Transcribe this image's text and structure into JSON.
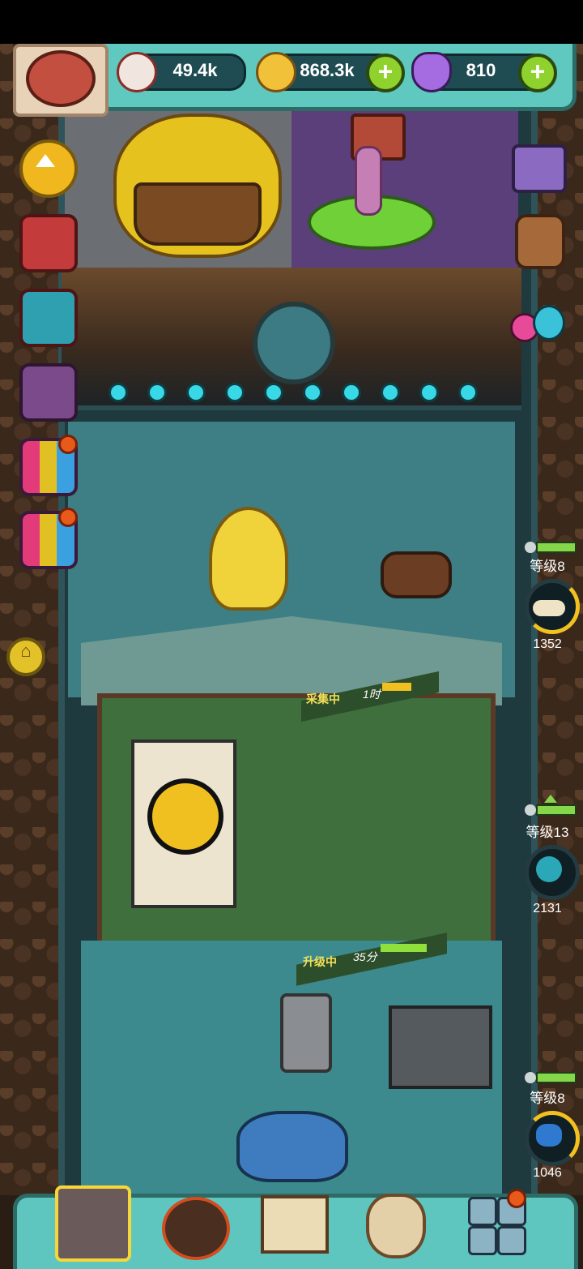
{
  "resources": {
    "eyes": {
      "value": "49.4k",
      "icon": "eyeball-icon"
    },
    "coins": {
      "value": "868.3k",
      "icon": "coin-icon"
    },
    "potion": {
      "value": "810",
      "icon": "potion-icon"
    },
    "plus_glyph": "+"
  },
  "rooms": [
    {
      "level": "等级8",
      "output": "1352",
      "resource_icon": "bone-icon"
    },
    {
      "level": "等级13",
      "output": "2131",
      "resource_icon": "sea-urchin-icon"
    },
    {
      "level": "等级8",
      "output": "1046",
      "resource_icon": "blue-ore-icon"
    }
  ],
  "timers": [
    {
      "label": "采集中",
      "time": "1时",
      "progress": 0.6,
      "color": "#f0c020"
    },
    {
      "label": "升级中",
      "time": "35分",
      "progress": 0.75,
      "color": "#8fe03a"
    }
  ],
  "home_glyph": "⌂",
  "colors": {
    "panel": "#5fc9c0",
    "accent_green": "#8fd22d",
    "badge": "#e85a1a"
  }
}
